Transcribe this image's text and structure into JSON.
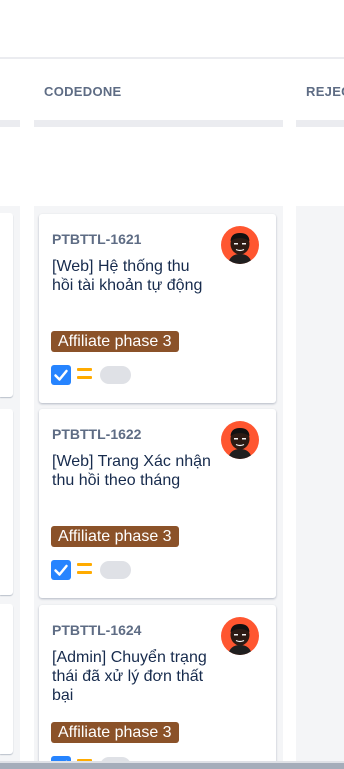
{
  "board": {
    "columns": [
      {
        "name": "",
        "header": ""
      },
      {
        "name": "codedone",
        "header": "CODEDONE"
      },
      {
        "name": "rejected",
        "header": "REJEC"
      }
    ],
    "cards": [
      {
        "key": "PTBTTL-1621",
        "title": "[Web] Hệ thống thu hồi tài khoản tự động",
        "epic": "Affiliate phase 3",
        "done": true,
        "priority": "medium",
        "avatar": "user-avatar-icon"
      },
      {
        "key": "PTBTTL-1622",
        "title": "[Web] Trang Xác nhận thu hồi theo tháng",
        "epic": "Affiliate phase 3",
        "done": true,
        "priority": "medium",
        "avatar": "user-avatar-icon"
      },
      {
        "key": "PTBTTL-1624",
        "title": "[Admin] Chuyển trạng thái đã xử lý đơn thất bại",
        "epic": "Affiliate phase 3",
        "done": true,
        "priority": "medium",
        "avatar": "user-avatar-icon"
      }
    ]
  },
  "colors": {
    "epic": "#8b5229",
    "avatar_bg": "#ff5630",
    "checkbox": "#2684ff",
    "priority": "#ffab00",
    "column_bg": "#f4f5f7"
  }
}
